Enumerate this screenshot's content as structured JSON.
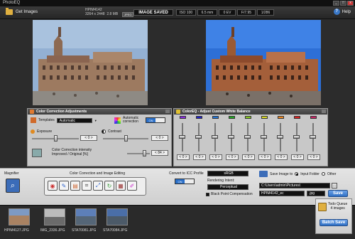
{
  "window": {
    "title": "PhotoEQ"
  },
  "toolbar": {
    "get_images": "Get Images",
    "file_name": "HPIM4142",
    "file_dims": "3264 x 2448",
    "file_size": "2.8 MB",
    "format_badge": "JPEG",
    "status": "IMAGE SAVED",
    "exif": [
      "ISO 100",
      "6.5 mm",
      "0 EV",
      "F/7.95",
      "1/286"
    ],
    "help": "Help"
  },
  "cca": {
    "title": "Color Correction Adjustments",
    "templates_label": "Templates",
    "templates_value": "Automatic",
    "auto_label_1": "Automatic",
    "auto_label_2": "correction",
    "toggle_on": "ON",
    "toggle_off": "",
    "exposure_label": "Exposure",
    "exposure_value": "< 0 >",
    "contrast_label": "Contrast",
    "contrast_value": "< 0 >",
    "intensity_label_1": "Color Correction intensity",
    "intensity_label_2": "Improved / Original [%]",
    "intensity_value": "< 84 >"
  },
  "coloreq": {
    "title": "ColorEQ - Adjust Custom White Balance",
    "colors": [
      "#8a2be2",
      "#2222cc",
      "#2277dd",
      "#22aa22",
      "#88cc22",
      "#dddd22",
      "#ee8822",
      "#dd2222",
      "#cc2266"
    ],
    "values": [
      "< 0 >",
      "< 0 >",
      "< 0 >",
      "< 0 >",
      "< 0 >",
      "< 0 >",
      "< 0 >",
      "< 0 >",
      "< 0 >"
    ]
  },
  "magnifier": {
    "label": "Magnifier"
  },
  "editing": {
    "label": "Color Correction and Image Editing"
  },
  "icc": {
    "label": "Convert to ICC Profile",
    "profile": "sRGB",
    "intent_label": "Rendering Intent:",
    "intent_value": "Perceptual",
    "toggle": "ON",
    "bpc": "Black Point Compensation"
  },
  "save": {
    "label": "Save Image to",
    "opt1": "Input Folder",
    "opt2": "Other",
    "path": "C:\\Users\\admin\\Pictures\\",
    "filename": "HPIM4142_ec",
    "ext": ".jpg",
    "button": "Save"
  },
  "tray": {
    "thumbs": [
      "HPIM4127.JPG",
      "IMG_2336.JPG",
      "STA70081.JPG",
      "STA70084.JPG"
    ]
  },
  "queue": {
    "title": "Todo Queue",
    "count": "4 images",
    "button": "Batch Save"
  }
}
